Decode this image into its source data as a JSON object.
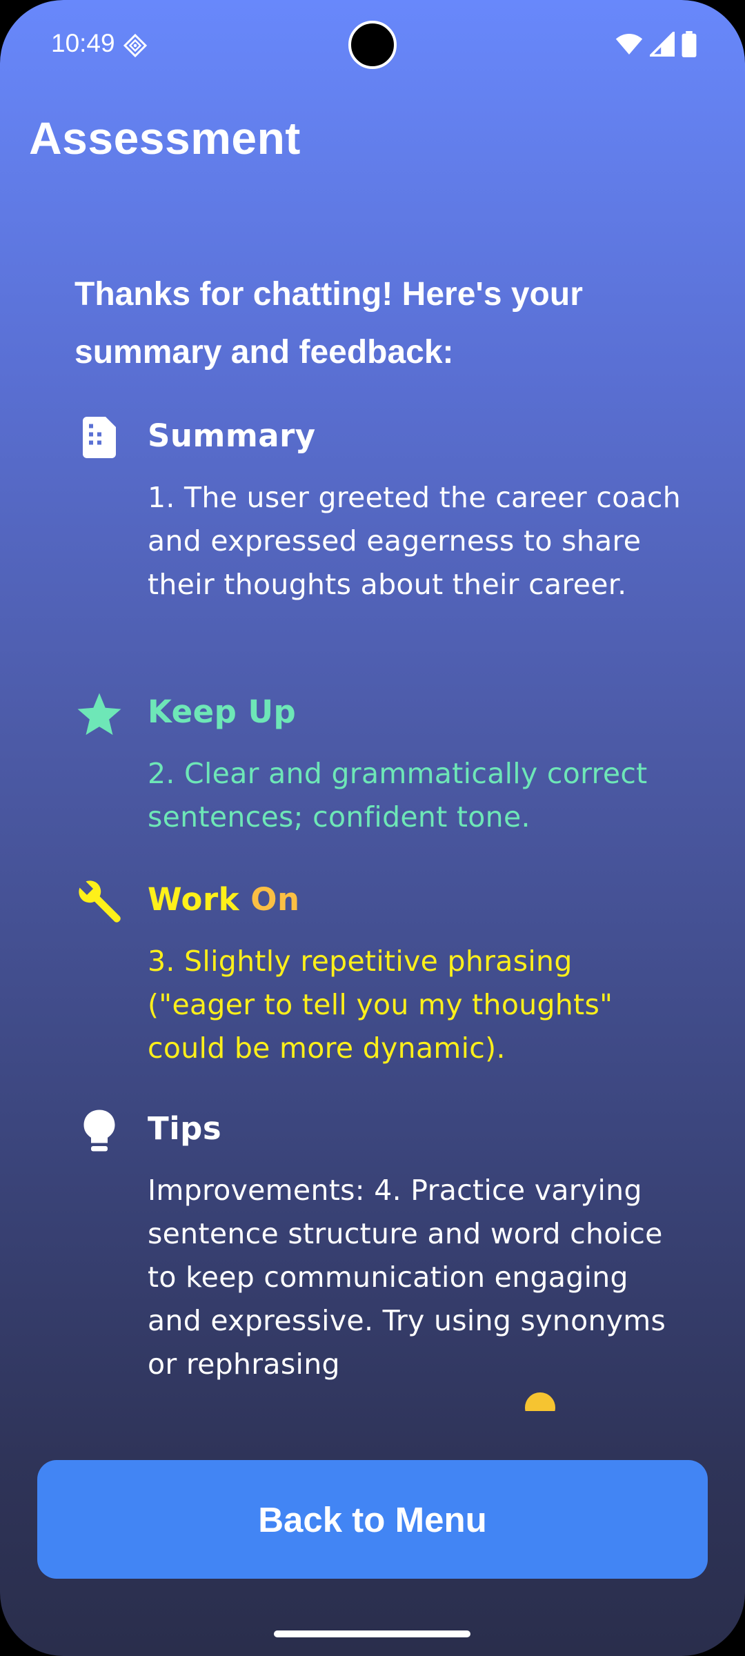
{
  "status_bar": {
    "time": "10:49",
    "icons": [
      "diamond-notification-icon",
      "wifi-icon",
      "signal-icon",
      "battery-icon"
    ]
  },
  "header": {
    "title": "Assessment"
  },
  "main": {
    "intro": "Thanks for chatting! Here's your summary and feedback:",
    "sections": [
      {
        "icon": "document-icon",
        "heading": "Summary",
        "body": "1.  The user greeted the career coach and expressed eagerness to share their thoughts about their career.",
        "color": "#ffffff"
      },
      {
        "icon": "star-icon",
        "heading": "Keep Up",
        "body": "2.  Clear and grammatically correct sentences; confident tone.",
        "color": "#6ee7b7"
      },
      {
        "icon": "wrench-icon",
        "heading_part1": "Work",
        "heading_part2": "On",
        "body": "3.  Slightly repetitive phrasing (\"eager to tell you my thoughts\" could be more dynamic).",
        "color": "#fef01a",
        "accent_color": "#fbbf44"
      },
      {
        "icon": "lightbulb-icon",
        "heading": "Tips",
        "body": "Improvements: 4.  Practice varying sentence structure and word choice to keep communication engaging and expressive. Try using synonyms or rephrasing",
        "color": "#ffffff"
      }
    ]
  },
  "footer": {
    "back_button_label": "Back to Menu",
    "button_color": "#4285f4"
  }
}
